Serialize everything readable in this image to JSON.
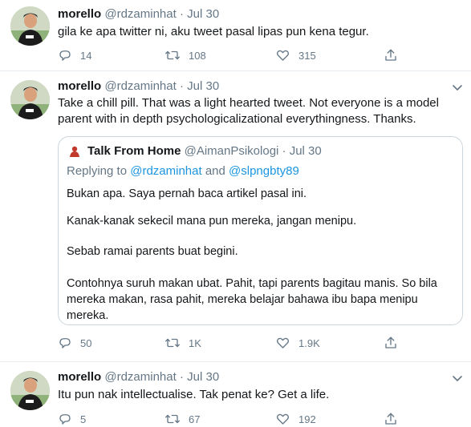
{
  "tweets": [
    {
      "name": "morello",
      "handle": "@rdzaminhat",
      "sep": "·",
      "date": "Jul 30",
      "text": "gila ke apa twitter ni, aku tweet pasal lipas pun kena tegur.",
      "replies": "14",
      "retweets": "108",
      "likes": "315"
    },
    {
      "name": "morello",
      "handle": "@rdzaminhat",
      "sep": "·",
      "date": "Jul 30",
      "text": "Take a chill pill. That was a light hearted tweet. Not everyone is a model parent with in depth psychologicalizational everythingness. Thanks.",
      "replies": "50",
      "retweets": "1K",
      "likes": "1.9K",
      "quote": {
        "name": "Talk From Home",
        "handle": "@AimanPsikologi",
        "sep": "·",
        "date": "Jul 30",
        "replying_prefix": "Replying to",
        "replying_user1": "@rdzaminhat",
        "replying_and": "and",
        "replying_user2": "@slpngbty89",
        "paragraphs": [
          "Bukan apa. Saya pernah baca artikel pasal ini.",
          "Kanak-kanak sekecil mana pun mereka, jangan menipu.",
          "Sebab ramai parents buat begini.",
          "Contohnya suruh makan ubat. Pahit, tapi parents bagitau manis. So bila mereka makan, rasa pahit, mereka belajar bahawa ibu bapa menipu mereka."
        ]
      }
    },
    {
      "name": "morello",
      "handle": "@rdzaminhat",
      "sep": "·",
      "date": "Jul 30",
      "text": "Itu pun nak intellectualise. Tak penat ke? Get a life.",
      "replies": "5",
      "retweets": "67",
      "likes": "192"
    }
  ],
  "icons": {
    "reply": "reply-icon",
    "retweet": "retweet-icon",
    "like": "heart-icon",
    "share": "share-icon",
    "more": "chevron-down-icon"
  },
  "colors": {
    "text": "#14171a",
    "muted": "#657786",
    "link": "#1b95e0",
    "divider": "#e6ecf0"
  }
}
